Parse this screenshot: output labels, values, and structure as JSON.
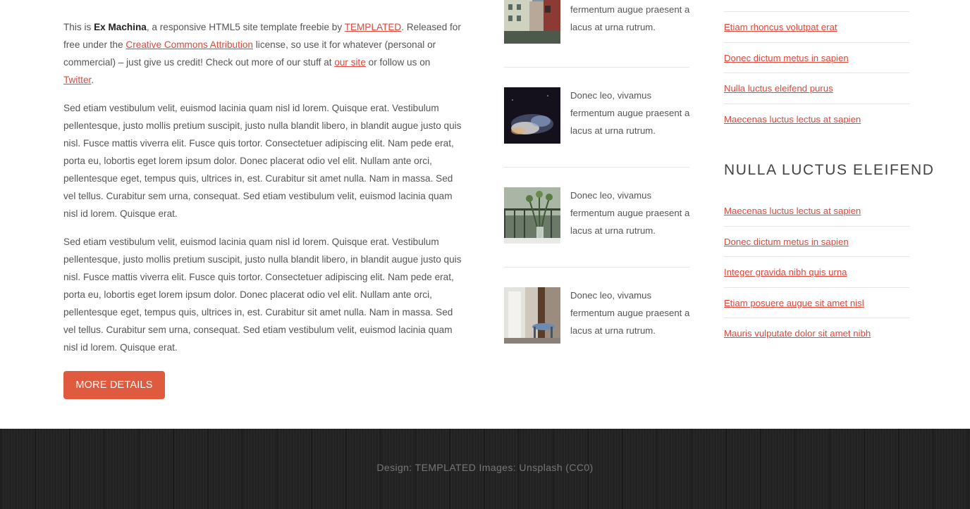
{
  "intro": {
    "p1_prefix": "This is ",
    "p1_brand": "Ex Machina",
    "p1_a": ", a responsive HTML5 site template freebie by ",
    "p1_link1": "TEMPLATED",
    "p1_b": ". Released for free under the ",
    "p1_link2": "Creative Commons Attribution",
    "p1_c": " license, so use it for whatever (personal or commercial) – just give us credit! Check out more of our stuff at ",
    "p1_link3": "our site",
    "p1_d": " or follow us on ",
    "p1_link4": "Twitter",
    "p1_e": ".",
    "p2": "Sed etiam vestibulum velit, euismod lacinia quam nisl id lorem. Quisque erat. Vestibulum pellentesque, justo mollis pretium suscipit, justo nulla blandit libero, in blandit augue justo quis nisl. Fusce mattis viverra elit. Fusce quis tortor. Consectetuer adipiscing elit. Nam pede erat, porta eu, lobortis eget lorem ipsum dolor. Donec placerat odio vel elit. Nullam ante orci, pellentesque eget, tempus quis, ultrices in, est. Curabitur sit amet nulla. Nam in massa. Sed vel tellus. Curabitur sem urna, consequat. Sed etiam vestibulum velit, euismod lacinia quam nisl id lorem. Quisque erat.",
    "p3": "Sed etiam vestibulum velit, euismod lacinia quam nisl id lorem. Quisque erat. Vestibulum pellentesque, justo mollis pretium suscipit, justo nulla blandit libero, in blandit augue justo quis nisl. Fusce mattis viverra elit. Fusce quis tortor. Consectetuer adipiscing elit. Nam pede erat, porta eu, lobortis eget lorem ipsum dolor. Donec placerat odio vel elit. Nullam ante orci, pellentesque eget, tempus quis, ultrices in, est. Curabitur sit amet nulla. Nam in massa. Sed vel tellus. Curabitur sem urna, consequat. Sed etiam vestibulum velit, euismod lacinia quam nisl id lorem. Quisque erat.",
    "button": "MORE DETAILS"
  },
  "posts": [
    {
      "text": "fermentum augue praesent a lacus at urna rutrum."
    },
    {
      "text": "Donec leo, vivamus fermentum augue praesent a lacus at urna rutrum."
    },
    {
      "text": "Donec leo, vivamus fermentum augue praesent a lacus at urna rutrum."
    },
    {
      "text": "Donec leo, vivamus fermentum augue praesent a lacus at urna rutrum."
    }
  ],
  "sidebar": {
    "list1": [
      "Etiam rhoncus volutpat erat",
      "Donec dictum metus in sapien",
      "Nulla luctus eleifend purus",
      "Maecenas luctus lectus at sapien"
    ],
    "heading": "NULLA LUCTUS ELEIFEND",
    "list2": [
      "Maecenas luctus lectus at sapien",
      "Donec dictum metus in sapien",
      "Integer gravida nibh quis urna",
      "Etiam posuere augue sit amet nisl",
      "Mauris vulputate dolor sit amet nibh"
    ]
  },
  "footer": {
    "text": "Design: TEMPLATED Images: Unsplash (CC0)"
  },
  "colors": {
    "accent": "#e05a3f",
    "link": "#e0473a",
    "footer_bg": "#222222"
  }
}
